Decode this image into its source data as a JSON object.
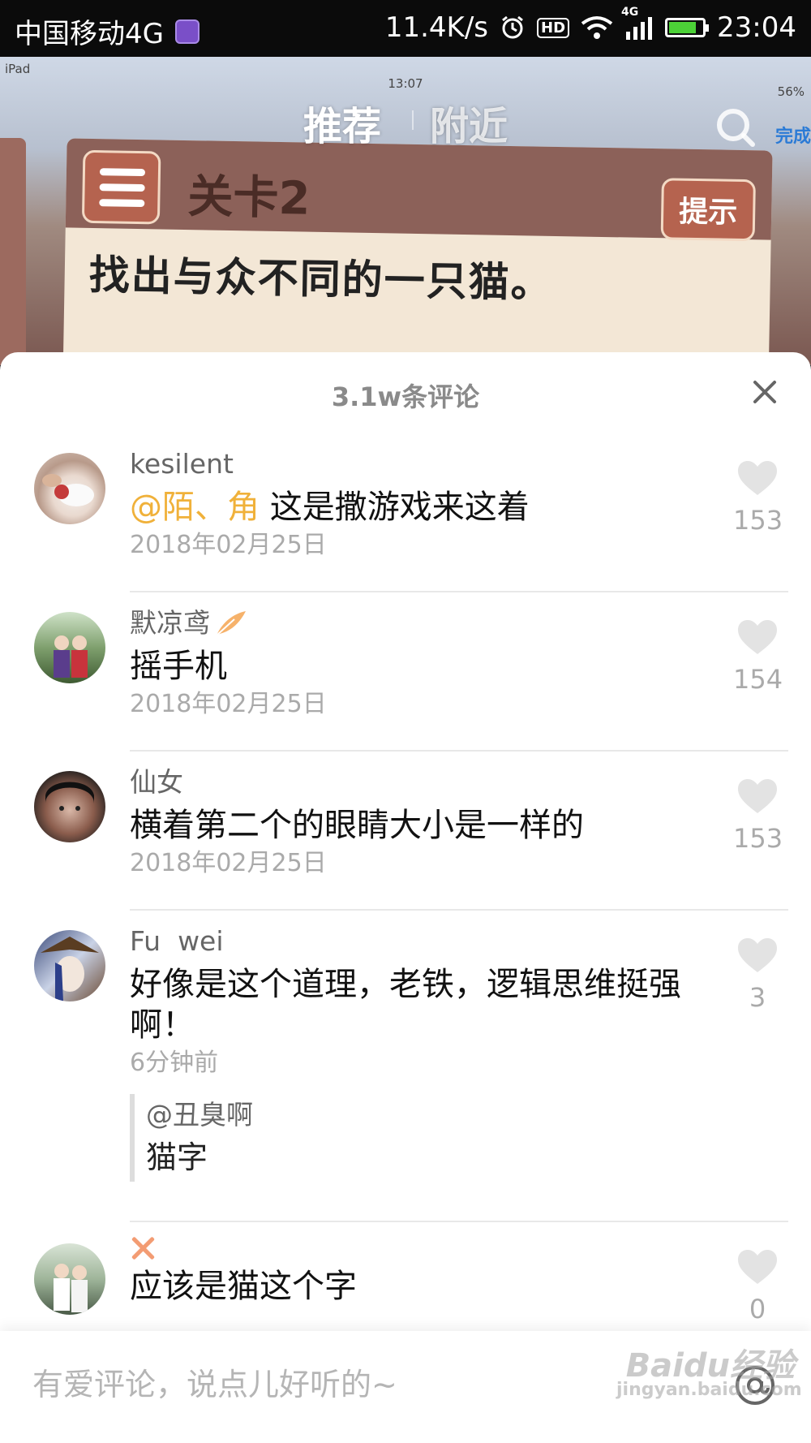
{
  "status_bar": {
    "carrier": "中国移动4G",
    "speed": "11.4K/s",
    "hd": "HD",
    "network": "4G",
    "time": "23:04"
  },
  "video": {
    "ipad_left": "iPad",
    "ipad_time": "13:07",
    "ipad_battery": "56%",
    "game_level": "关卡2",
    "game_hint": "提示",
    "game_task": "找出与众不同的一只猫。"
  },
  "top_nav": {
    "tab_recommend": "推荐",
    "tab_nearby": "附近",
    "done": "完成"
  },
  "sheet": {
    "title": "3.1w条评论"
  },
  "comments": [
    {
      "username": "kesilent",
      "mention": "@陌、角",
      "text": " 这是撒游戏来这着",
      "time": "2018年02月25日",
      "likes": "153"
    },
    {
      "username": "默凉鸢",
      "text": "摇手机",
      "time": "2018年02月25日",
      "likes": "154"
    },
    {
      "username": "仙女",
      "text": "横着第二个的眼睛大小是一样的",
      "time": "2018年02月25日",
      "likes": "153"
    },
    {
      "username": "Fu  wei",
      "text": "好像是这个道理，老铁，逻辑思维挺强啊！",
      "time": "6分钟前",
      "likes": "3",
      "reply_user": "@丑臭啊",
      "reply_text": "猫字"
    },
    {
      "username": "",
      "text": "应该是猫这个字",
      "likes": "0"
    }
  ],
  "input": {
    "placeholder": "有爱评论，说点儿好听的~"
  },
  "watermark": {
    "brand": "Baidu经验",
    "url": "jingyan.baidu.com"
  }
}
